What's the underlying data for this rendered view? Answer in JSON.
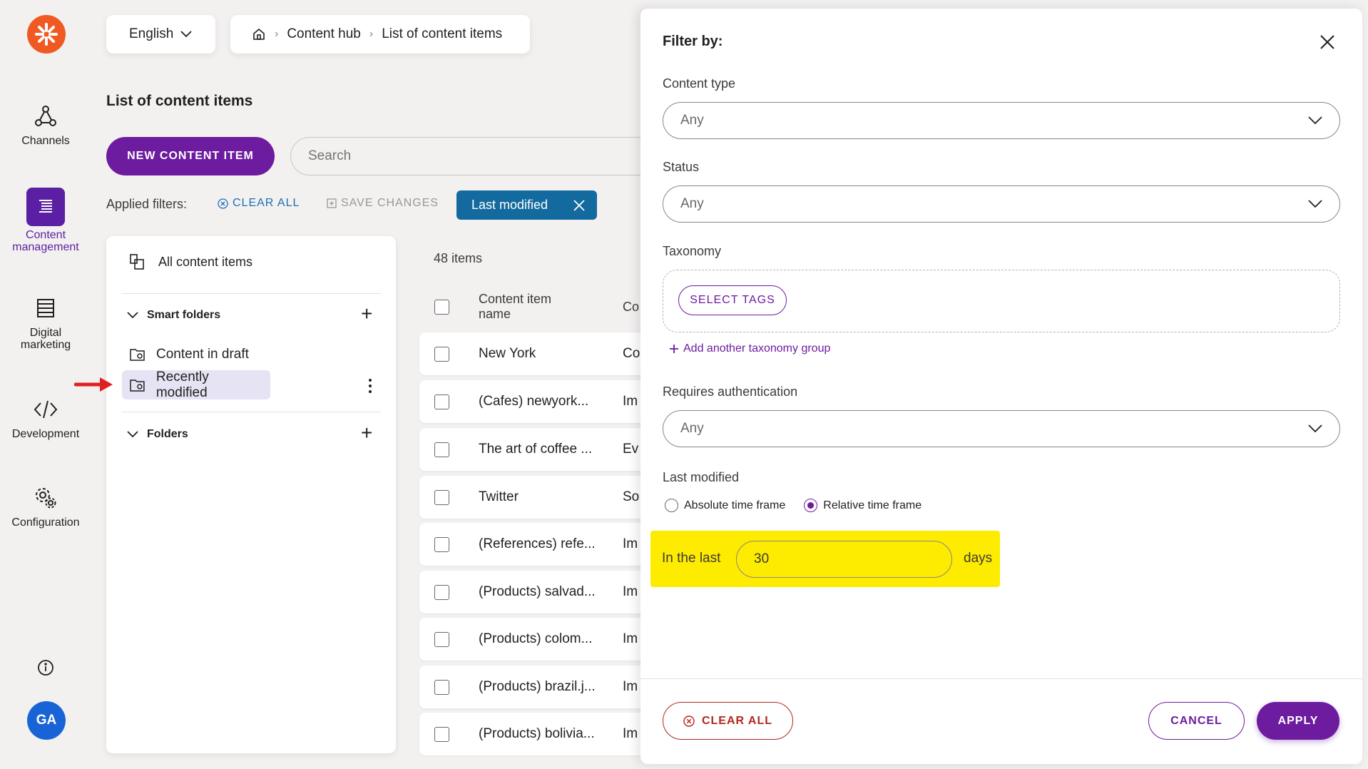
{
  "nav": {
    "items": [
      {
        "label": "Channels"
      },
      {
        "label": "Content management"
      },
      {
        "label": "Digital marketing"
      },
      {
        "label": "Development"
      },
      {
        "label": "Configuration"
      }
    ],
    "avatar_initials": "GA"
  },
  "header": {
    "language": "English",
    "breadcrumb": [
      "Content hub",
      "List of content items"
    ]
  },
  "main": {
    "title": "List of content items",
    "new_button": "NEW CONTENT ITEM",
    "search_placeholder": "Search",
    "applied_filters_label": "Applied filters:",
    "clear_all": "CLEAR ALL",
    "save_changes": "SAVE CHANGES",
    "filter_chip": "Last modified"
  },
  "folders": {
    "all_items": "All content items",
    "smart_folders": "Smart folders",
    "smart_items": [
      {
        "label": "Content in draft"
      },
      {
        "label": "Recently modified"
      }
    ],
    "folders_label": "Folders"
  },
  "list": {
    "count": "48 items",
    "header_name": "Content item name",
    "header_type": "Co",
    "rows": [
      {
        "name": "New York",
        "type": "Co"
      },
      {
        "name": "(Cafes) newyork...",
        "type": "Im"
      },
      {
        "name": "The art of coffee ...",
        "type": "Ev"
      },
      {
        "name": "Twitter",
        "type": "So"
      },
      {
        "name": "(References) refe...",
        "type": "Im"
      },
      {
        "name": "(Products) salvad...",
        "type": "Im"
      },
      {
        "name": "(Products) colom...",
        "type": "Im"
      },
      {
        "name": "(Products) brazil.j...",
        "type": "Im"
      },
      {
        "name": "(Products) bolivia...",
        "type": "Im"
      }
    ]
  },
  "filter": {
    "title": "Filter by:",
    "content_type_label": "Content type",
    "content_type_value": "Any",
    "status_label": "Status",
    "status_value": "Any",
    "taxonomy_label": "Taxonomy",
    "select_tags": "SELECT TAGS",
    "add_taxonomy": "Add another taxonomy group",
    "auth_label": "Requires authentication",
    "auth_value": "Any",
    "last_modified_label": "Last modified",
    "absolute_label": "Absolute time frame",
    "relative_label": "Relative time frame",
    "in_the_last": "In the last",
    "days_value": "30",
    "days_label": "days",
    "clear_all": "CLEAR ALL",
    "cancel": "CANCEL",
    "apply": "APPLY"
  },
  "colors": {
    "brand_purple": "#6d1b9f",
    "logo_orange": "#f05a22",
    "chip_blue": "#136a9e",
    "highlight_yellow": "#fdeb00",
    "danger_red": "#b3261e"
  }
}
